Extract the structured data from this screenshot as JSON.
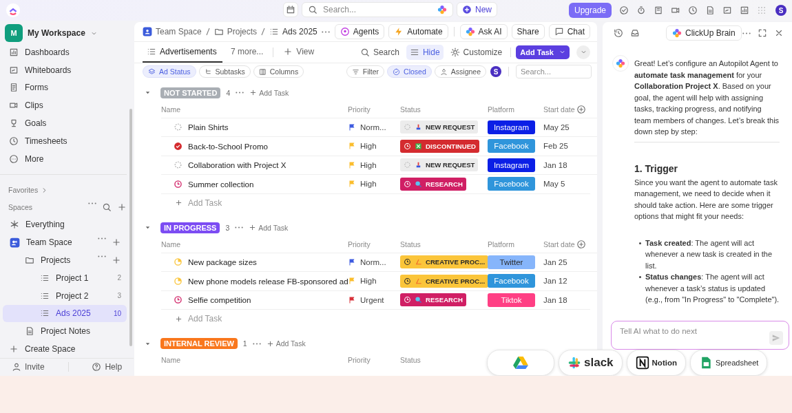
{
  "topbar": {
    "search_placeholder": "Search...",
    "new_button": "New",
    "upgrade_button": "Upgrade",
    "avatar": "S"
  },
  "sidebar": {
    "workspace": {
      "initial": "M",
      "name": "My Workspace"
    },
    "nav": [
      {
        "label": "Dashboards"
      },
      {
        "label": "Whiteboards"
      },
      {
        "label": "Forms"
      },
      {
        "label": "Clips"
      },
      {
        "label": "Goals"
      },
      {
        "label": "Timesheets"
      },
      {
        "label": "More"
      }
    ],
    "favorites": "Favorites",
    "spaces": "Spaces",
    "tree": [
      {
        "label": "Everything",
        "kind": "everything",
        "selected": false
      },
      {
        "label": "Team Space",
        "kind": "space",
        "selected": false,
        "children": [
          {
            "label": "Projects",
            "kind": "folder",
            "selected": false,
            "children": [
              {
                "label": "Project 1",
                "kind": "list",
                "count": "2",
                "selected": false
              },
              {
                "label": "Project 2",
                "kind": "list",
                "count": "3",
                "selected": false
              },
              {
                "label": "Ads 2025",
                "kind": "list",
                "count": "10",
                "selected": true
              }
            ]
          },
          {
            "label": "Project Notes",
            "kind": "doc",
            "selected": false
          }
        ]
      }
    ],
    "create_space": "Create Space",
    "invite": "Invite",
    "help": "Help"
  },
  "main": {
    "breadcrumb": [
      "Team Space",
      "Projects",
      "Ads 2025"
    ],
    "actions": [
      "Agents",
      "Automate",
      "Ask AI",
      "Share",
      "Chat"
    ],
    "views": [
      {
        "label": "Advertisements",
        "selected": true
      },
      {
        "label": "7 more...",
        "selected": false
      }
    ],
    "add_view": "View",
    "tools": [
      {
        "label": "Search",
        "selected": false
      },
      {
        "label": "Hide",
        "selected": true
      },
      {
        "label": "Customize",
        "selected": false
      }
    ],
    "add_task_button": "Add Task",
    "chips_left": [
      {
        "label": "Ad Status",
        "selected": true
      },
      {
        "label": "Subtasks",
        "selected": false
      },
      {
        "label": "Columns",
        "selected": false
      }
    ],
    "chips_right": [
      {
        "label": "Filter",
        "selected": false
      },
      {
        "label": "Closed",
        "selected": true
      },
      {
        "label": "Assignee",
        "selected": false
      }
    ],
    "assignee_avatar": "S",
    "search_placeholder": "Search...",
    "groups": [
      {
        "name": "NOT STARTED",
        "color": "#a9aeb4",
        "count": "4",
        "add_task": "Add Task",
        "columns": [
          "Name",
          "Priority",
          "Status",
          "Platform",
          "Start date"
        ],
        "add_row": "Add Task",
        "tasks": [
          {
            "name": "Plain Shirts",
            "priority": {
              "label": "Norm...",
              "color": "#3d5be0"
            },
            "status": {
              "label": "NEW REQUEST",
              "kind": "new",
              "color": "#ececec"
            },
            "platform": {
              "label": "Instagram",
              "color": "#0b1fe6"
            },
            "start": "May 25"
          },
          {
            "name": "Back-to-School Promo",
            "priority": {
              "label": "High",
              "color": "#fbbd2c"
            },
            "status": {
              "label": "DISCONTINUED",
              "kind": "discontinued",
              "color": "#d42b2f"
            },
            "platform": {
              "label": "Facebook",
              "color": "#2f95db"
            },
            "start": "Feb 25"
          },
          {
            "name": "Collaboration with Project X",
            "priority": {
              "label": "High",
              "color": "#fbbd2c"
            },
            "status": {
              "label": "NEW REQUEST",
              "kind": "new",
              "color": "#ececec"
            },
            "platform": {
              "label": "Instagram",
              "color": "#0b1fe6"
            },
            "start": "Jan 18"
          },
          {
            "name": "Summer collection",
            "priority": {
              "label": "High",
              "color": "#fbbd2c"
            },
            "status": {
              "label": "RESEARCH",
              "kind": "research",
              "color": "#d01f64"
            },
            "platform": {
              "label": "Facebook",
              "color": "#2f95db"
            },
            "start": "May 5"
          }
        ]
      },
      {
        "name": "IN PROGRESS",
        "color": "#7c4cf3",
        "count": "3",
        "add_task": "Add Task",
        "columns": [
          "Name",
          "Priority",
          "Status",
          "Platform",
          "Start date"
        ],
        "add_row": "Add Task",
        "tasks": [
          {
            "name": "New package sizes",
            "priority": {
              "label": "Norm...",
              "color": "#3d5be0"
            },
            "status": {
              "label": "CREATIVE PROC...",
              "kind": "creative",
              "color": "#fbc53a"
            },
            "platform": {
              "label": "Twitter",
              "color": "#86b5fb"
            },
            "start": "Jan 25"
          },
          {
            "name": "New phone models release FB-sponsored ad",
            "priority": {
              "label": "High",
              "color": "#fbbd2c"
            },
            "status": {
              "label": "CREATIVE PROC...",
              "kind": "creative",
              "color": "#fbc53a"
            },
            "platform": {
              "label": "Facebook",
              "color": "#2f95db"
            },
            "start": "Jan 12"
          },
          {
            "name": "Selfie competition",
            "priority": {
              "label": "Urgent",
              "color": "#d8323a"
            },
            "status": {
              "label": "RESEARCH",
              "kind": "research",
              "color": "#d01f64"
            },
            "platform": {
              "label": "Tiktok",
              "color": "#ff3f84"
            },
            "start": "Jan 18"
          }
        ]
      },
      {
        "name": "INTERNAL REVIEW",
        "color": "#f9771d",
        "count": "1",
        "add_task": "Add Task",
        "columns": [
          "Name",
          "Priority",
          "Status"
        ]
      }
    ]
  },
  "chat": {
    "title": "ClickUp Brain",
    "message": "Great! Let’s configure an Autopilot Agent to **automate task management** for your **Collaboration Project X**. Based on your goal, the agent will help with assigning tasks, tracking progress, and notifying team members of changes. Let’s break this down step by step:",
    "heading": "1. Trigger",
    "body": "Since you want the agent to automate task management, we need to decide when it should take action. Here are some trigger options that might fit your needs:",
    "bullets": [
      "**Task created**: The agent will act whenever a new task is created in the list.",
      "**Status changes**: The agent will act whenever a task’s status is updated (e.g., from \"In Progress\" to \"Complete\")."
    ],
    "input_placeholder": "Tell AI what to do next"
  },
  "integrations": [
    {
      "kind": "drive"
    },
    {
      "kind": "slack",
      "label": "slack"
    },
    {
      "kind": "notion",
      "label": "Notion"
    },
    {
      "kind": "sheet",
      "label": "Spreadsheet"
    }
  ]
}
